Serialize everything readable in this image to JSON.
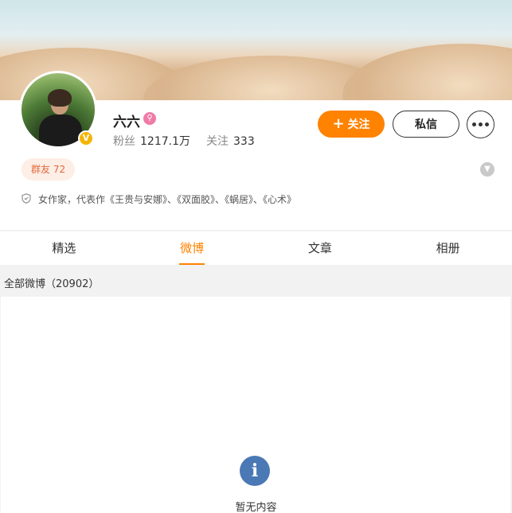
{
  "profile": {
    "name": "六六",
    "fans_label": "粉丝",
    "fans_value": "1217.1万",
    "following_label": "关注",
    "following_value": "333",
    "follow_button": "关注",
    "message_button": "私信",
    "fan_group": "群友 72",
    "bio": "女作家，代表作《王贵与安娜》、《双面胶》、《蜗居》、《心术》",
    "verified_badge": "V"
  },
  "tabs": [
    {
      "label": "精选",
      "active": false
    },
    {
      "label": "微博",
      "active": true
    },
    {
      "label": "文章",
      "active": false
    },
    {
      "label": "相册",
      "active": false
    }
  ],
  "feed": {
    "title": "全部微博（20902）",
    "empty_text": "暂无内容"
  },
  "colors": {
    "accent": "#ff8200",
    "empty_icon": "#4b79b5",
    "vip": "#f07aa6",
    "verified": "#f5b400"
  },
  "icons": {
    "verified": "verified-badge-icon",
    "vip": "vip-icon",
    "more": "more-dots-icon",
    "expand": "chevron-down-icon",
    "bio": "shield-icon",
    "empty": "info-icon",
    "follow": "plus-icon"
  }
}
